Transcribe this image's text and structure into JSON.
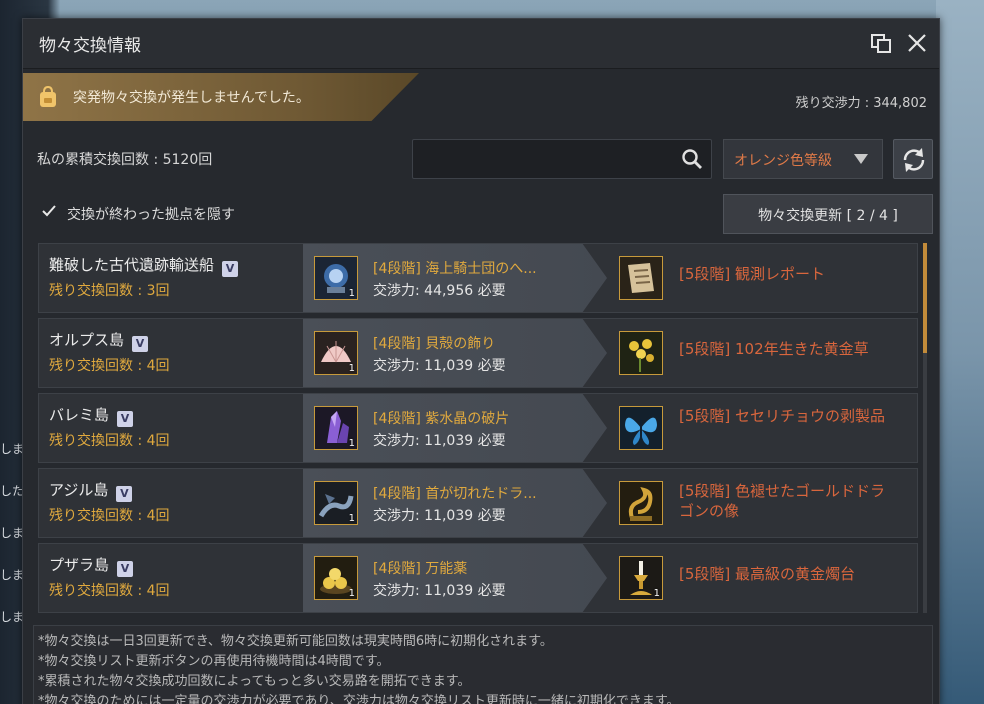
{
  "window": {
    "title": "物々交換情報"
  },
  "notice": {
    "text": "突発物々交換が発生しませんでした。"
  },
  "header": {
    "remaining_power": "残り交渉力 : 344,802",
    "cumulative_count": "私の累積交換回数 : 5120回"
  },
  "search": {
    "value": "",
    "placeholder": ""
  },
  "filter": {
    "grade_label": "オレンジ色等級"
  },
  "options": {
    "hide_finished_label": "交換が終わった拠点を隠す",
    "hide_finished_checked": true,
    "update_button": "物々交換更新 [ 2 / 4 ]"
  },
  "rows": [
    {
      "name": "難破した古代遺跡輸送船",
      "remaining": "残り交換回数 : 3回",
      "give_name": "[4段階] 海上騎士団のへ...",
      "give_cost": "交渉力: 44,956 必要",
      "give_qty": "1",
      "get_name": "[5段階] 観測レポート"
    },
    {
      "name": "オルプス島",
      "remaining": "残り交換回数 : 4回",
      "give_name": "[4段階] 貝殻の飾り",
      "give_cost": "交渉力: 11,039 必要",
      "give_qty": "1",
      "get_name": "[5段階] 102年生きた黄金草"
    },
    {
      "name": "バレミ島",
      "remaining": "残り交換回数 : 4回",
      "give_name": "[4段階] 紫水晶の破片",
      "give_cost": "交渉力: 11,039 必要",
      "give_qty": "1",
      "get_name": "[5段階] セセリチョウの剥製品"
    },
    {
      "name": "アジル島",
      "remaining": "残り交換回数 : 4回",
      "give_name": "[4段階] 首が切れたドラ...",
      "give_cost": "交渉力: 11,039 必要",
      "give_qty": "1",
      "get_name": "[5段階] 色褪せたゴールドドラゴンの像"
    },
    {
      "name": "プザラ島",
      "remaining": "残り交換回数 : 4回",
      "give_name": "[4段階] 万能薬",
      "give_cost": "交渉力: 11,039 必要",
      "give_qty": "1",
      "get_name": "[5段階] 最高級の黄金燭台",
      "get_qty": "1"
    }
  ],
  "footer": {
    "lines": [
      "*物々交換は一日3回更新でき、物々交換更新可能回数は現実時間6時に初期化されます。",
      "*物々交換リスト更新ボタンの再使用待機時間は4時間です。",
      "*累積された物々交換成功回数によってもっと多い交易路を開拓できます。",
      "*物々交換のためには一定量の交渉力が必要であり、交渉力は物々交換リスト更新時に一緒に初期化できます。"
    ]
  },
  "background_chat": [
    "しま",
    "した",
    "しま",
    "しま",
    "しま"
  ],
  "colors": {
    "accent_gold": "#e0a93e",
    "reward_orange": "#d9663d",
    "notice_bar": "#8f7447"
  }
}
